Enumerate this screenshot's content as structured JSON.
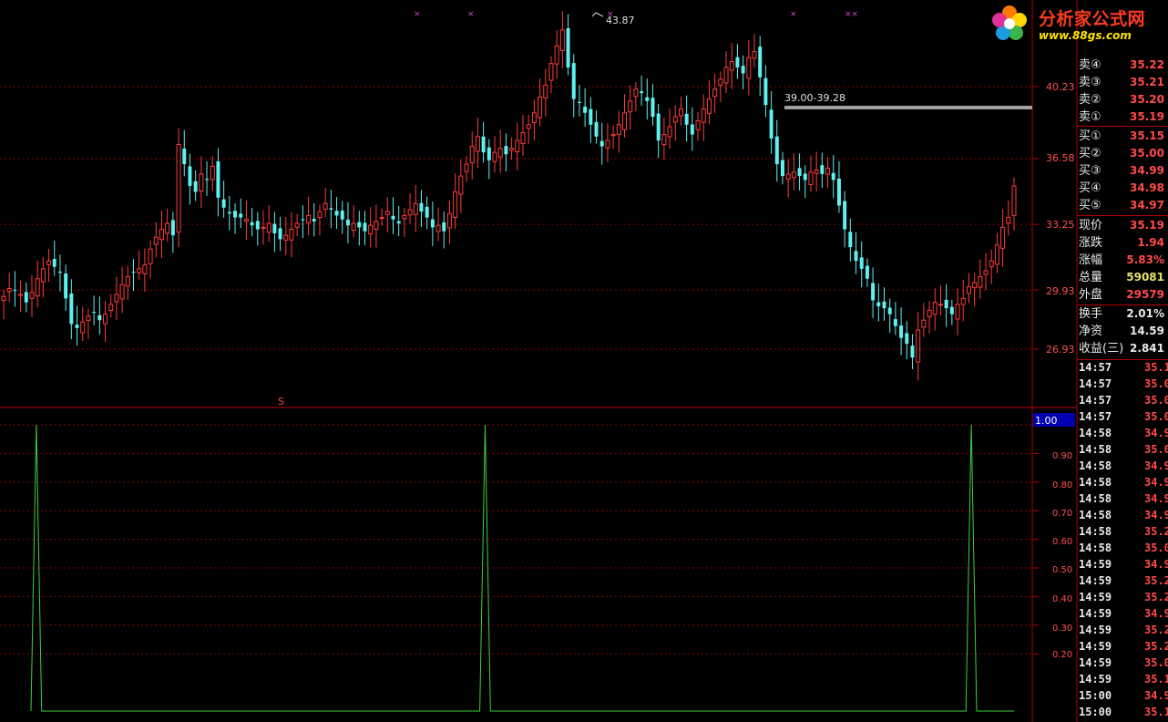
{
  "price_chart": {
    "y_ticks": [
      "40.23",
      "36.58",
      "33.25",
      "29.93",
      "26.93"
    ],
    "high_label": "43.87",
    "range_label": "39.00-39.28",
    "marker_top": [
      "×",
      "×",
      "×",
      "×",
      "××"
    ],
    "signal_marker": "S"
  },
  "indicator": {
    "current_value": "1.00",
    "y_ticks": [
      "1.00",
      "0.90",
      "0.80",
      "0.70",
      "0.60",
      "0.50",
      "0.40",
      "0.30",
      "0.20"
    ]
  },
  "logo": {
    "title": "分析家公式网",
    "url": "www.88gs.com"
  },
  "quote_panel": {
    "order_book": [
      {
        "label": "卖④",
        "value": "35.22"
      },
      {
        "label": "卖③",
        "value": "35.21"
      },
      {
        "label": "卖②",
        "value": "35.20"
      },
      {
        "label": "卖①",
        "value": "35.19"
      },
      {
        "label": "买①",
        "value": "35.15"
      },
      {
        "label": "买②",
        "value": "35.00"
      },
      {
        "label": "买③",
        "value": "34.99"
      },
      {
        "label": "买④",
        "value": "34.98"
      },
      {
        "label": "买⑤",
        "value": "34.97"
      }
    ],
    "stats": [
      {
        "label": "现价",
        "value": "35.19",
        "color": "#ff4a4a"
      },
      {
        "label": "涨跌",
        "value": "1.94",
        "color": "#ff4a4a"
      },
      {
        "label": "涨幅",
        "value": "5.83%",
        "color": "#ff4a4a"
      },
      {
        "label": "总量",
        "value": "59081",
        "color": "#e8e26a"
      },
      {
        "label": "外盘",
        "value": "29579",
        "color": "#ff4a4a"
      },
      {
        "label": "换手",
        "value": "2.01%",
        "color": "#e8e8e8"
      },
      {
        "label": "净资",
        "value": "14.59",
        "color": "#e8e8e8"
      },
      {
        "label": "收益(三)",
        "value": "2.841",
        "color": "#e8e8e8"
      }
    ]
  },
  "trades": [
    {
      "time": "14:57",
      "price": "35.1"
    },
    {
      "time": "14:57",
      "price": "35.0"
    },
    {
      "time": "14:57",
      "price": "35.0"
    },
    {
      "time": "14:57",
      "price": "35.0"
    },
    {
      "time": "14:58",
      "price": "34.9"
    },
    {
      "time": "14:58",
      "price": "35.0"
    },
    {
      "time": "14:58",
      "price": "34.9"
    },
    {
      "time": "14:58",
      "price": "34.9"
    },
    {
      "time": "14:58",
      "price": "34.9"
    },
    {
      "time": "14:58",
      "price": "34.9"
    },
    {
      "time": "14:58",
      "price": "35.2"
    },
    {
      "time": "14:58",
      "price": "35.0"
    },
    {
      "time": "14:59",
      "price": "34.9"
    },
    {
      "time": "14:59",
      "price": "35.2"
    },
    {
      "time": "14:59",
      "price": "35.2"
    },
    {
      "time": "14:59",
      "price": "34.9"
    },
    {
      "time": "14:59",
      "price": "35.2"
    },
    {
      "time": "14:59",
      "price": "35.2"
    },
    {
      "time": "14:59",
      "price": "35.0"
    },
    {
      "time": "14:59",
      "price": "35.1"
    },
    {
      "time": "15:00",
      "price": "34.9"
    },
    {
      "time": "15:00",
      "price": "35.1"
    }
  ],
  "colors": {
    "up": "#ff3b3b",
    "down": "#5ff0f0",
    "grid": "#8b0000",
    "indicator_line": "#3cd23c",
    "range_bar": "#a0a0a0"
  },
  "chart_data": [
    {
      "type": "candlestick",
      "y_ticks": [
        40.23,
        36.58,
        33.25,
        29.93,
        26.93
      ],
      "annotations": [
        "43.87",
        "39.00-39.28"
      ],
      "close_series": [
        29.6,
        30.0,
        29.9,
        29.7,
        29.3,
        29.8,
        30.5,
        31.0,
        31.4,
        31.1,
        30.8,
        29.5,
        28.2,
        28.0,
        28.3,
        28.6,
        28.8,
        28.4,
        28.7,
        29.2,
        29.7,
        30.2,
        30.6,
        30.8,
        31.0,
        31.2,
        32.0,
        32.6,
        33.0,
        33.3,
        32.7,
        37.3,
        36.3,
        35.2,
        34.9,
        35.8,
        35.5,
        36.2,
        34.6,
        34.1,
        33.8,
        33.6,
        33.6,
        33.5,
        33.2,
        33.0,
        33.1,
        33.3,
        32.8,
        32.5,
        32.7,
        33.0,
        33.3,
        33.5,
        33.7,
        33.4,
        33.9,
        34.3,
        34.0,
        33.7,
        33.5,
        33.2,
        33.3,
        33.1,
        32.9,
        33.2,
        33.4,
        33.6,
        33.9,
        33.5,
        33.3,
        33.7,
        34.0,
        34.3,
        33.9,
        33.6,
        33.1,
        33.2,
        32.9,
        33.8,
        34.9,
        35.7,
        36.3,
        37.2,
        37.7,
        36.9,
        36.5,
        36.9,
        37.1,
        36.8,
        37.1,
        37.5,
        37.9,
        38.3,
        38.9,
        39.7,
        40.3,
        41.4,
        42.3,
        43.1,
        41.2,
        39.6,
        39.4,
        38.9,
        38.3,
        37.7,
        37.2,
        37.5,
        37.8,
        38.3,
        38.9,
        39.5,
        40.1,
        39.9,
        39.5,
        38.7,
        37.5,
        37.8,
        38.2,
        38.7,
        39.1,
        38.3,
        37.8,
        38.5,
        39.1,
        39.6,
        40.1,
        40.6,
        41.2,
        41.5,
        41.2,
        40.9,
        41.7,
        42.0,
        40.7,
        39.3,
        37.6,
        36.3,
        35.7,
        35.8,
        35.9,
        35.7,
        35.5,
        35.9,
        36.0,
        35.8,
        36.1,
        35.5,
        34.2,
        33.0,
        32.1,
        31.4,
        31.0,
        30.5,
        29.4,
        29.1,
        29.0,
        28.7,
        28.1,
        27.5,
        27.2,
        26.5,
        27.9,
        28.4,
        28.9,
        29.3,
        29.2,
        29.0,
        28.7,
        29.2,
        29.5,
        30.1,
        30.3,
        30.6,
        30.9,
        31.4,
        32.2,
        33.1,
        33.6,
        35.19
      ]
    },
    {
      "type": "line",
      "y_ticks": [
        1.0,
        0.9,
        0.8,
        0.7,
        0.6,
        0.5,
        0.4,
        0.3,
        0.2
      ],
      "ylim": [
        0,
        1
      ],
      "series": [
        {
          "values": [
            0,
            1,
            0,
            0,
            0,
            0,
            0,
            0,
            0,
            0,
            0,
            0,
            0,
            0,
            0,
            0,
            0,
            0,
            0,
            0,
            0,
            0,
            0,
            0,
            0,
            0,
            0,
            0,
            0,
            0,
            0,
            0,
            0,
            0,
            0,
            0,
            0,
            0,
            0,
            0,
            0,
            0,
            0,
            0,
            0,
            0,
            0,
            0,
            0,
            0,
            0,
            0,
            0,
            0,
            0,
            0,
            0,
            0,
            0,
            0,
            0,
            0,
            0,
            0,
            0,
            0,
            0,
            0,
            0,
            0,
            0,
            0,
            0,
            0,
            0,
            0,
            0,
            0,
            0,
            0,
            0,
            0,
            0,
            0,
            0,
            1,
            0,
            0,
            0,
            0,
            0,
            0,
            0,
            0,
            0,
            0,
            0,
            0,
            0,
            0,
            0,
            0,
            0,
            0,
            0,
            0,
            0,
            0,
            0,
            0,
            0,
            0,
            0,
            0,
            0,
            0,
            0,
            0,
            0,
            0,
            0,
            0,
            0,
            0,
            0,
            0,
            0,
            0,
            0,
            0,
            0,
            0,
            0,
            0,
            0,
            0,
            0,
            0,
            0,
            0,
            0,
            0,
            0,
            0,
            0,
            0,
            0,
            0,
            0,
            0,
            0,
            0,
            0,
            0,
            0,
            0,
            0,
            0,
            0,
            0,
            0,
            0,
            0,
            0,
            0,
            0,
            0,
            0,
            0,
            0,
            0,
            0,
            0,
            0,
            0,
            0,
            1,
            0,
            0,
            0,
            0,
            0,
            0,
            0,
            0
          ]
        }
      ]
    }
  ]
}
